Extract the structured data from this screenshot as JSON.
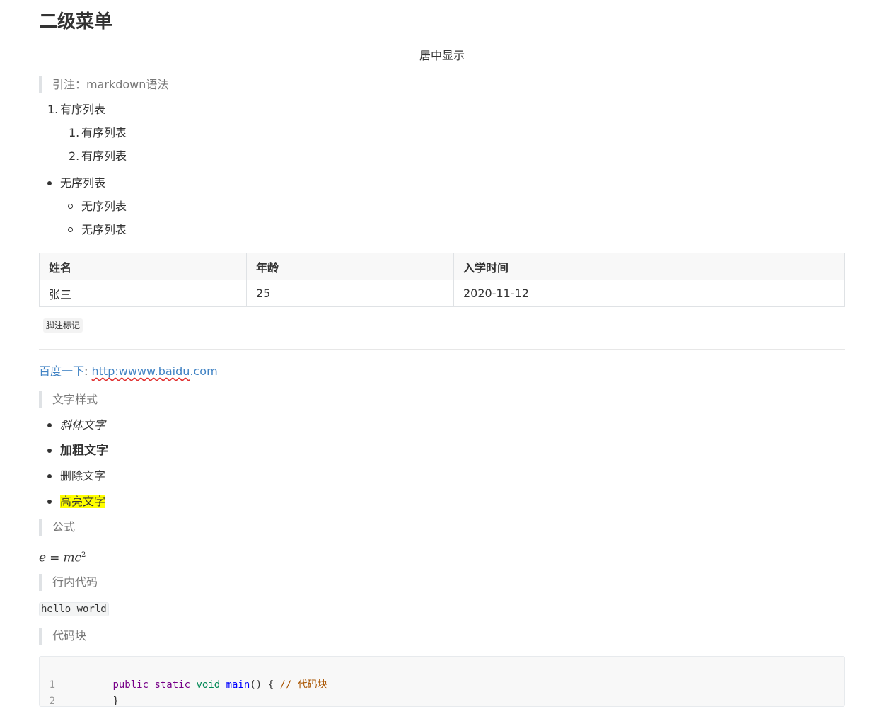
{
  "heading": "二级菜单",
  "centered_text": "居中显示",
  "quote_markdown": "引注：markdown语法",
  "ordered_list": {
    "item": "有序列表",
    "item_number": "1.",
    "sub_items": [
      {
        "number": "1.",
        "label": "有序列表"
      },
      {
        "number": "2.",
        "label": "有序列表"
      }
    ]
  },
  "unordered_list": {
    "item": "无序列表",
    "sub_items": [
      "无序列表",
      "无序列表"
    ]
  },
  "table": {
    "headers": [
      "姓名",
      "年龄",
      "入学时间"
    ],
    "rows": [
      [
        "张三",
        "25",
        "2020-11-12"
      ]
    ]
  },
  "footnote": "脚注标记",
  "link": {
    "label": "百度一下",
    "separator": ": ",
    "url_text": "http:wwww.baidu.com",
    "url_part1": "http:wwww.baidu",
    "url_part2": ".com"
  },
  "quote_text_styles": "文字样式",
  "text_styles": {
    "italic": "斜体文字",
    "bold": "加粗文字",
    "strike": "删除文字",
    "highlight": "高亮文字"
  },
  "colors": {
    "link": "#4183c4",
    "highlight": "#ffff00",
    "quote_bar": "#dfe2e5"
  },
  "quote_formula": "公式",
  "formula": {
    "lhs": "e",
    "eq": "=",
    "rhs": "mc",
    "exp": "2"
  },
  "quote_inline_code": "行内代码",
  "inline_code": "hello world",
  "quote_code_block": "代码块",
  "code_block": {
    "lines": [
      {
        "number": "1",
        "kw1": "public",
        "kw2": "static",
        "type": "void",
        "fn": "main",
        "rest": "() { ",
        "comment": "// 代码块"
      },
      {
        "number": "2",
        "text": "}"
      }
    ]
  }
}
